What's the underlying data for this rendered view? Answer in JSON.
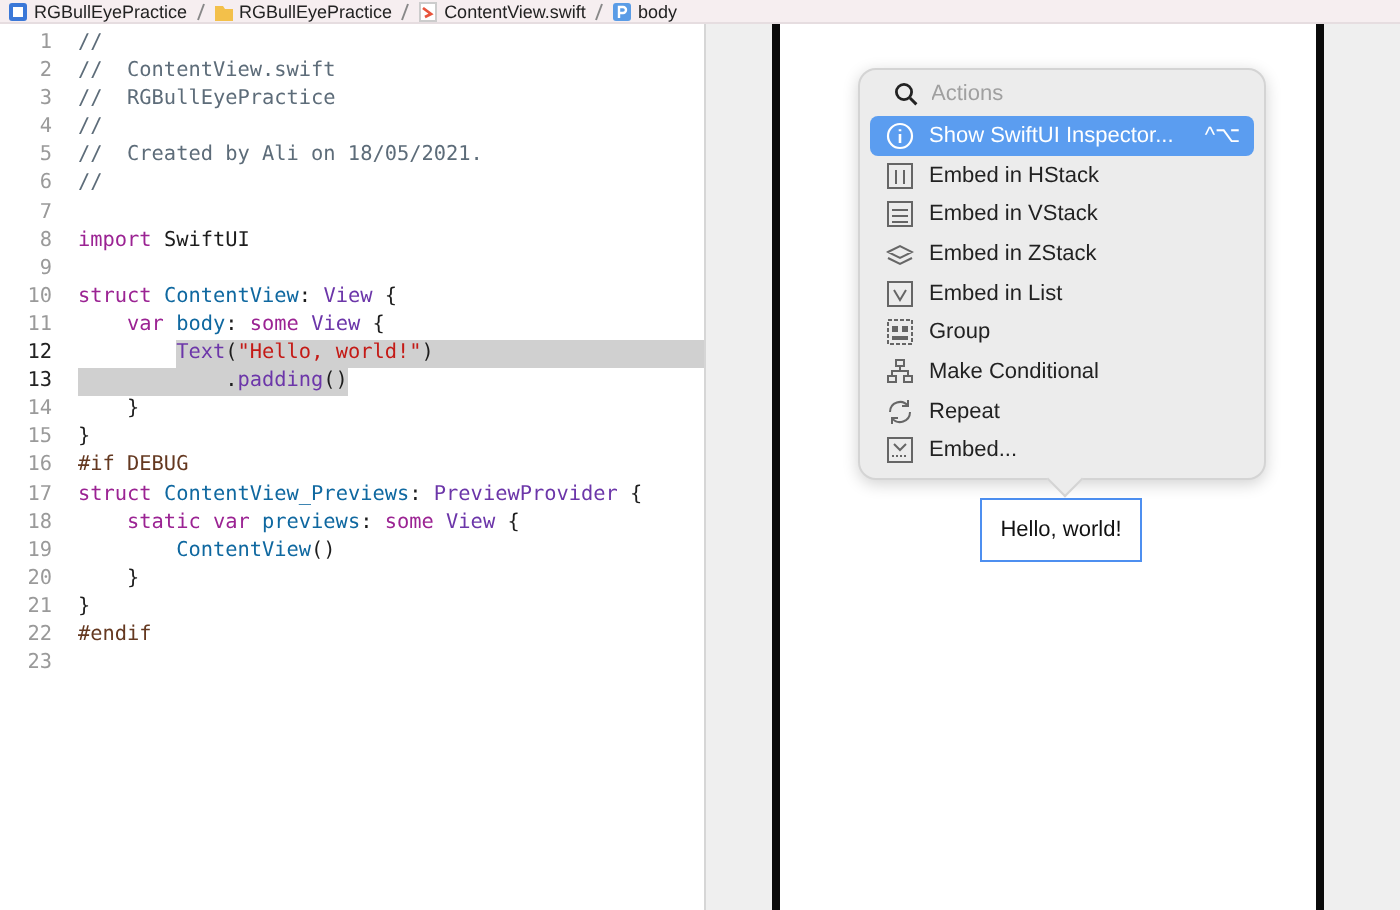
{
  "breadcrumb": [
    {
      "kind": "project",
      "label": "RGBullEyePractice"
    },
    {
      "kind": "folder",
      "label": "RGBullEyePractice"
    },
    {
      "kind": "swift",
      "label": "ContentView.swift"
    },
    {
      "kind": "property",
      "label": "body"
    }
  ],
  "editor": {
    "lines": [
      {
        "number": "1",
        "selected": false,
        "tokens": [
          {
            "kind": "comment",
            "text": "//"
          }
        ]
      },
      {
        "number": "2",
        "selected": false,
        "tokens": [
          {
            "kind": "comment",
            "text": "//  ContentView.swift"
          }
        ]
      },
      {
        "number": "3",
        "selected": false,
        "tokens": [
          {
            "kind": "comment",
            "text": "//  RGBullEyePractice"
          }
        ]
      },
      {
        "number": "4",
        "selected": false,
        "tokens": [
          {
            "kind": "comment",
            "text": "//"
          }
        ]
      },
      {
        "number": "5",
        "selected": false,
        "tokens": [
          {
            "kind": "comment",
            "text": "//  Created by Ali on 18/05/2021."
          }
        ]
      },
      {
        "number": "6",
        "selected": false,
        "tokens": [
          {
            "kind": "comment",
            "text": "//"
          }
        ]
      },
      {
        "number": "7",
        "selected": false
      },
      {
        "number": "8",
        "selected": false,
        "tokens": [
          {
            "kind": "keyword",
            "text": "import"
          },
          {
            "kind": "plain",
            "text": " SwiftUI"
          }
        ]
      },
      {
        "number": "9",
        "selected": false
      },
      {
        "number": "10",
        "selected": false,
        "tokens": [
          {
            "kind": "keyword",
            "text": "struct"
          },
          {
            "kind": "decl",
            "text": " ContentView"
          },
          {
            "kind": "plain",
            "text": ": "
          },
          {
            "kind": "type",
            "text": "View"
          },
          {
            "kind": "plain",
            "text": " {"
          }
        ]
      },
      {
        "number": "11",
        "selected": false,
        "tokens": [
          {
            "kind": "keyword",
            "text": "    var"
          },
          {
            "kind": "decl",
            "text": " body"
          },
          {
            "kind": "plain",
            "text": ": "
          },
          {
            "kind": "keyword",
            "text": "some"
          },
          {
            "kind": "type",
            "text": " View"
          },
          {
            "kind": "plain",
            "text": " {"
          }
        ]
      },
      {
        "number": "12",
        "selected": true,
        "tokens": [
          {
            "kind": "type",
            "text": "        Text"
          },
          {
            "kind": "plain",
            "text": "("
          },
          {
            "kind": "string",
            "text": "\"Hello, world!\""
          },
          {
            "kind": "plain",
            "text": ")"
          }
        ]
      },
      {
        "number": "13",
        "selected": true,
        "tokens": [
          {
            "kind": "plain",
            "text": "            ."
          },
          {
            "kind": "type",
            "text": "padding"
          },
          {
            "kind": "plain",
            "text": "()"
          }
        ]
      },
      {
        "number": "14",
        "selected": false,
        "tokens": [
          {
            "kind": "plain",
            "text": "    }"
          }
        ]
      },
      {
        "number": "15",
        "selected": false,
        "tokens": [
          {
            "kind": "plain",
            "text": "}"
          }
        ]
      },
      {
        "number": "16",
        "selected": false,
        "tokens": [
          {
            "kind": "preproc",
            "text": "#if DEBUG"
          }
        ]
      },
      {
        "number": "17",
        "selected": false,
        "tokens": [
          {
            "kind": "keyword",
            "text": "struct"
          },
          {
            "kind": "decl",
            "text": " ContentView_Previews"
          },
          {
            "kind": "plain",
            "text": ": "
          },
          {
            "kind": "type",
            "text": "PreviewProvider"
          },
          {
            "kind": "plain",
            "text": " {"
          }
        ]
      },
      {
        "number": "18",
        "selected": false,
        "tokens": [
          {
            "kind": "keyword",
            "text": "    static var"
          },
          {
            "kind": "decl",
            "text": " previews"
          },
          {
            "kind": "plain",
            "text": ": "
          },
          {
            "kind": "keyword",
            "text": "some"
          },
          {
            "kind": "type",
            "text": " View"
          },
          {
            "kind": "plain",
            "text": " {"
          }
        ]
      },
      {
        "number": "19",
        "selected": false,
        "tokens": [
          {
            "kind": "decl",
            "text": "        ContentView"
          },
          {
            "kind": "plain",
            "text": "()"
          }
        ]
      },
      {
        "number": "20",
        "selected": false,
        "tokens": [
          {
            "kind": "plain",
            "text": "    }"
          }
        ]
      },
      {
        "number": "21",
        "selected": false,
        "tokens": [
          {
            "kind": "plain",
            "text": "}"
          }
        ]
      },
      {
        "number": "22",
        "selected": false,
        "tokens": [
          {
            "kind": "preproc",
            "text": "#endif"
          }
        ]
      },
      {
        "number": "23",
        "selected": false
      }
    ]
  },
  "preview": {
    "actions_menu": {
      "search": {
        "placeholder": "Actions"
      },
      "items": [
        {
          "kind": "info",
          "label": "Show SwiftUI Inspector...",
          "shortcut": "^⌥",
          "selected": true
        },
        {
          "kind": "hstack",
          "label": "Embed in HStack",
          "selected": false
        },
        {
          "kind": "vstack",
          "label": "Embed in VStack",
          "selected": false
        },
        {
          "kind": "zstack",
          "label": "Embed in ZStack",
          "selected": false
        },
        {
          "kind": "list",
          "label": "Embed in List",
          "selected": false
        },
        {
          "kind": "group",
          "label": "Group",
          "selected": false
        },
        {
          "kind": "conditional",
          "label": "Make Conditional",
          "selected": false
        },
        {
          "kind": "repeat",
          "label": "Repeat",
          "selected": false
        },
        {
          "kind": "embed",
          "label": "Embed...",
          "selected": false
        }
      ]
    },
    "text_view": {
      "text": "Hello, world!"
    }
  }
}
